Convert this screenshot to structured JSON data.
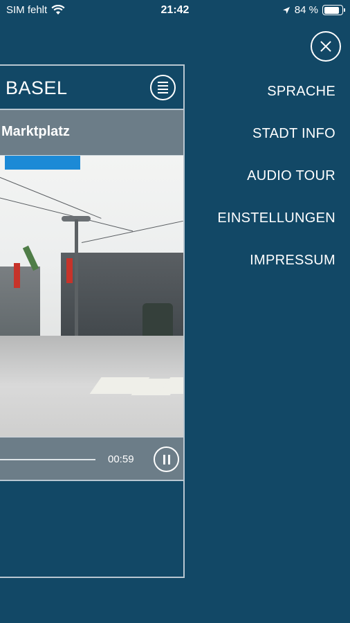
{
  "status_bar": {
    "carrier": "SIM fehlt",
    "time": "21:42",
    "battery": "84 %",
    "battery_level": 0.84,
    "icons": [
      "wifi-icon",
      "location-arrow-icon",
      "battery-icon"
    ]
  },
  "app": {
    "title": "BASEL",
    "station": "Marktplatz",
    "player": {
      "elapsed": "00:59",
      "progress": 1.0
    }
  },
  "side_menu": {
    "items": [
      {
        "label": "SPRACHE"
      },
      {
        "label": "STADT INFO"
      },
      {
        "label": "AUDIO TOUR"
      },
      {
        "label": "EINSTELLUNGEN"
      },
      {
        "label": "IMPRESSUM"
      }
    ]
  },
  "colors": {
    "background": "#124866",
    "panel": "#6c7d88",
    "accent": "#1c8ad6"
  }
}
